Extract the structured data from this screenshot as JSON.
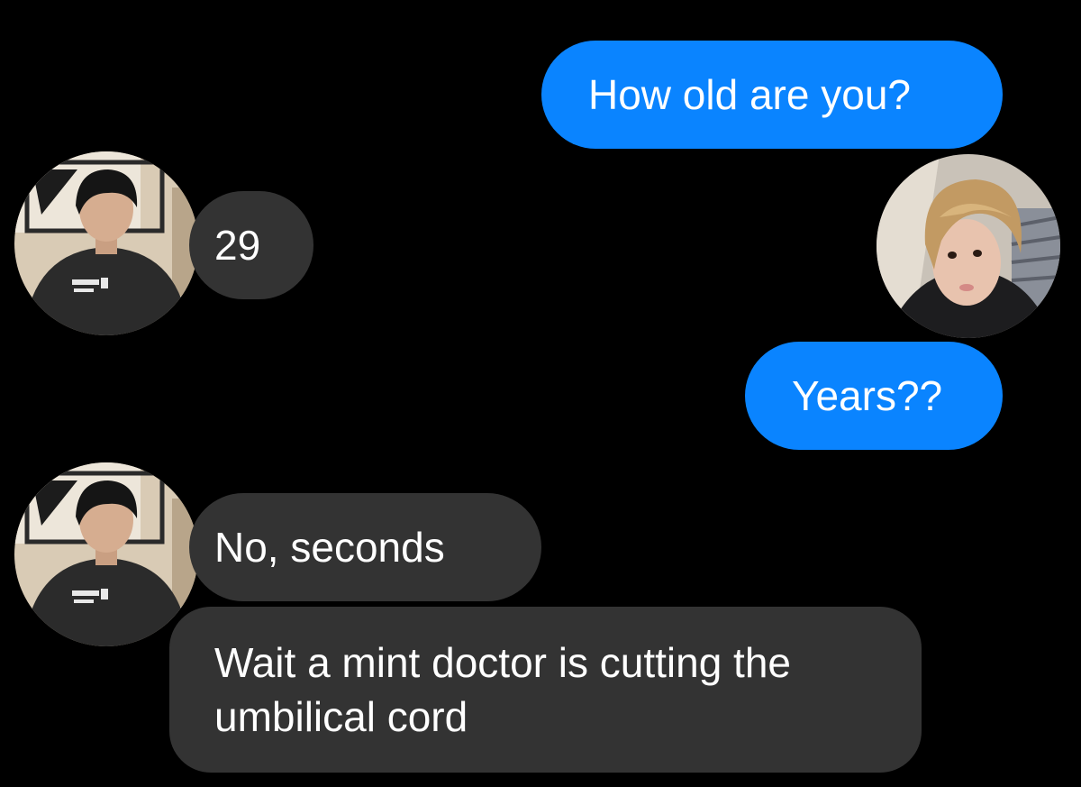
{
  "conversation": {
    "messages": [
      {
        "sender": "me",
        "text": "How old are you?"
      },
      {
        "sender": "contact-a",
        "text": "29"
      },
      {
        "sender": "me",
        "text": "Years??"
      },
      {
        "sender": "contact-a",
        "text": "No, seconds"
      },
      {
        "sender": "contact-a",
        "text": "Wait a mint doctor is cutting the umbilical cord"
      }
    ]
  },
  "colors": {
    "background": "#000000",
    "outgoing_bubble": "#0a84ff",
    "incoming_bubble": "#333333",
    "text": "#ffffff"
  },
  "icons": {
    "contact_avatar": "dark-haired-person-avatar",
    "my_avatar": "blond-haired-person-avatar"
  }
}
